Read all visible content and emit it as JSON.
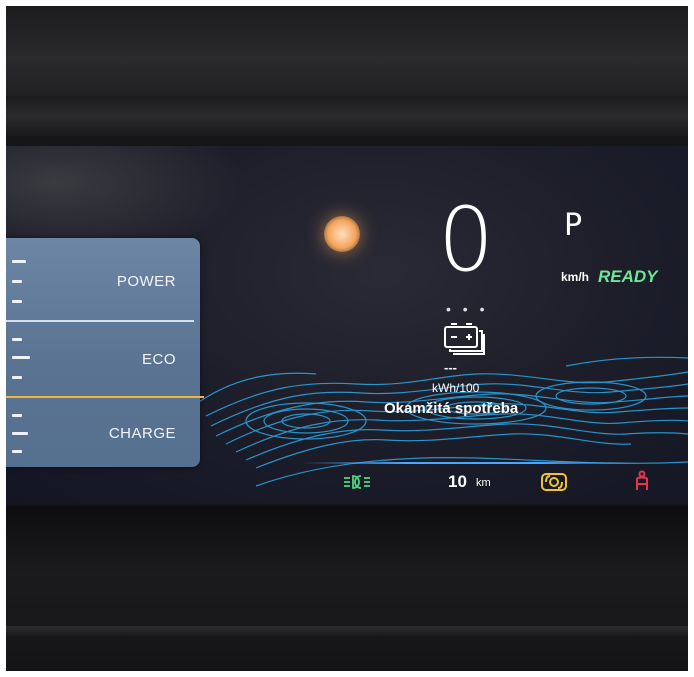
{
  "cluster": {
    "speed": "0",
    "gear": "P",
    "speed_unit": "km/h",
    "status": "READY",
    "status_color": "#6fe59a",
    "dots": "• • •",
    "consumption_value": "---",
    "consumption_unit": "kWh/100",
    "consumption_label": "Okamžitá spotřeba",
    "icons": [
      "sun-icon",
      "battery-icon",
      "headlight-icon",
      "esp-icon",
      "seat-icon"
    ]
  },
  "power_gauge": {
    "labels": [
      "POWER",
      "ECO",
      "CHARGE"
    ],
    "panel_color": "#6a83a3",
    "marker_color": "#f0b442"
  },
  "status_bar": {
    "range_value": "10",
    "range_unit": "km",
    "headlight_color": "#4fd27a",
    "esp_color": "#f1c232",
    "seat_color": "#e8344a"
  }
}
